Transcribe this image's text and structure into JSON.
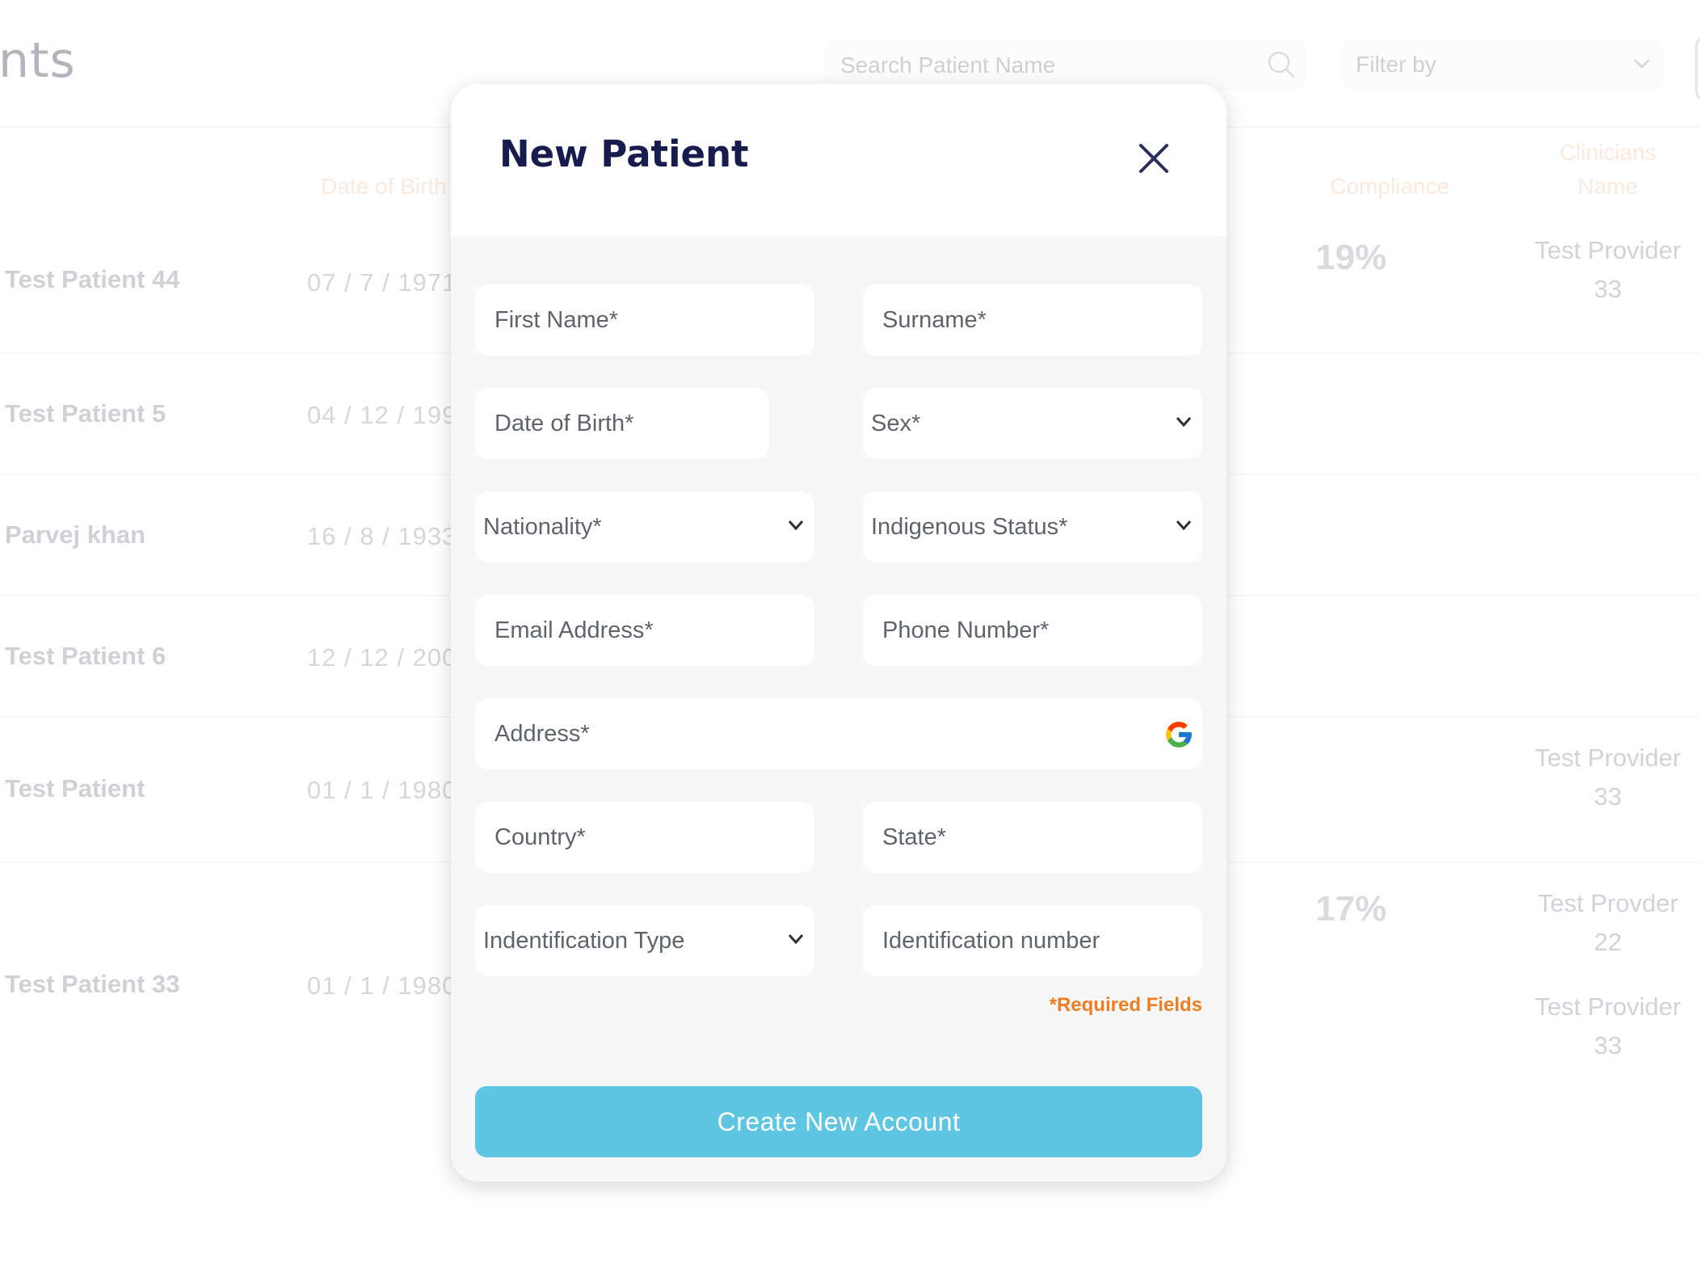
{
  "header": {
    "title_fragment": "nts",
    "search": {
      "placeholder": "Search Patient Name"
    },
    "filter": {
      "label": "Filter by"
    }
  },
  "table": {
    "columns": {
      "dob": "Date of Birth",
      "compliance": "Compliance",
      "clinicians_line1": "Clinicians",
      "clinicians_line2": "Name"
    },
    "rows": [
      {
        "name": "Test Patient 44",
        "dob": "07 / 7 / 1971",
        "compliance": "19%",
        "provider": [
          "Test Provider",
          "33"
        ]
      },
      {
        "name": "Test Patient 5",
        "dob": "04 / 12 / 199"
      },
      {
        "name": "Parvej khan",
        "dob": "16 / 8 / 1933"
      },
      {
        "name": "Test Patient 6",
        "dob": "12 / 12 / 200"
      },
      {
        "name": "Test Patient",
        "dob": "01 / 1 / 1980",
        "provider": [
          "Test Provider",
          "33"
        ]
      },
      {
        "name": "Test Patient 33",
        "dob": "01 / 1 / 1980",
        "compliance": "17%",
        "providers": [
          [
            "Test Provder",
            "22"
          ],
          [
            "Test Provider",
            "33"
          ]
        ]
      }
    ]
  },
  "modal": {
    "title": "New Patient",
    "fields": {
      "first_name": "First Name*",
      "surname": "Surname*",
      "date_of_birth": "Date of Birth*",
      "sex": "Sex*",
      "nationality": "Nationality*",
      "indigenous_status": "Indigenous Status*",
      "email": "Email Address*",
      "phone": "Phone Number*",
      "address": "Address*",
      "country": "Country*",
      "state": "State*",
      "identification_type": "Indentification Type",
      "identification_number": "Identification number"
    },
    "required_note": "*Required Fields",
    "submit_label": "Create New Account"
  },
  "colors": {
    "title": "#171b4e",
    "accent_button": "#5ec5e2",
    "required_text": "#ef7d22",
    "modal_body": "#f7f7f7"
  },
  "icons": [
    "search-icon",
    "chevron-down-icon",
    "close-icon",
    "google-icon"
  ]
}
